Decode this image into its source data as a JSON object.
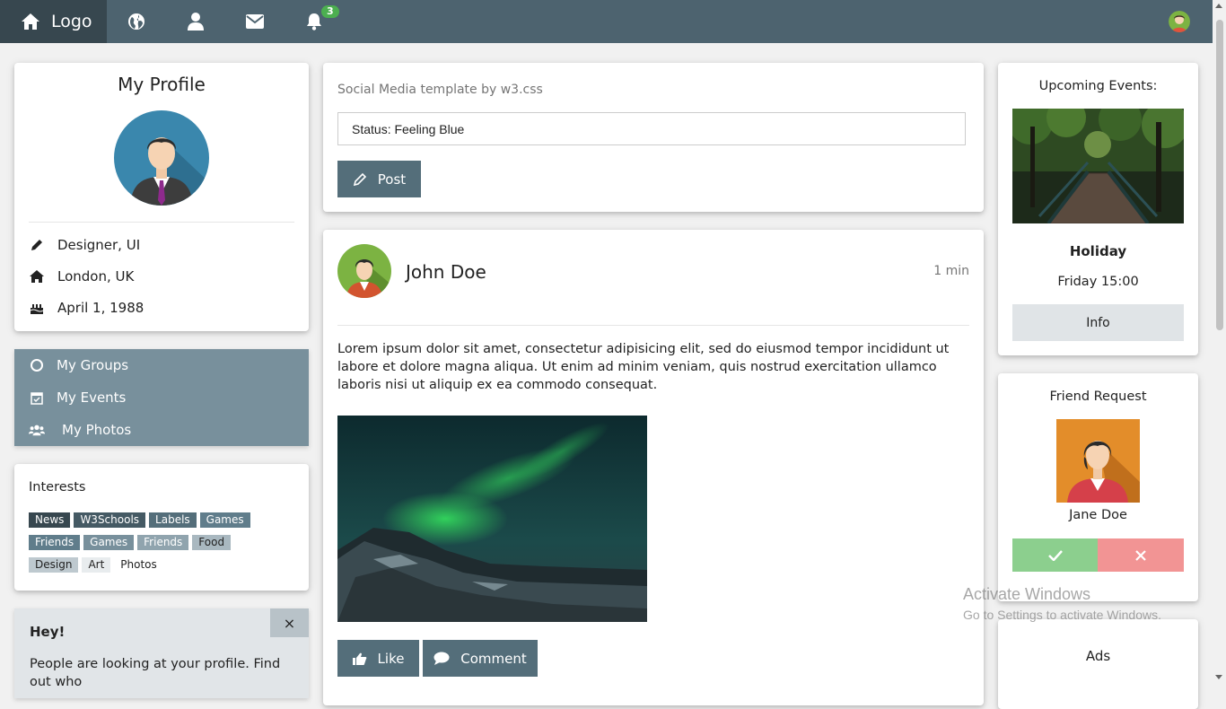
{
  "navbar": {
    "logo_label": "Logo",
    "notification_count": "3"
  },
  "profile": {
    "title": "My Profile",
    "job": "Designer, UI",
    "location": "London, UK",
    "birthday": "April 1, 1988"
  },
  "accordion": {
    "items": [
      {
        "label": "My Groups",
        "icon": "circle-icon"
      },
      {
        "label": "My Events",
        "icon": "calendar-check-icon"
      },
      {
        "label": "My Photos",
        "icon": "users-icon"
      }
    ]
  },
  "interests": {
    "title": "Interests",
    "tags": [
      {
        "label": "News",
        "bg": "#37474f",
        "fg": "#ffffff"
      },
      {
        "label": "W3Schools",
        "bg": "#455a64",
        "fg": "#ffffff"
      },
      {
        "label": "Labels",
        "bg": "#546e7a",
        "fg": "#ffffff"
      },
      {
        "label": "Games",
        "bg": "#607d8b",
        "fg": "#ffffff"
      },
      {
        "label": "Friends",
        "bg": "#607d8b",
        "fg": "#ffffff"
      },
      {
        "label": "Games",
        "bg": "#78909c",
        "fg": "#ffffff"
      },
      {
        "label": "Friends",
        "bg": "#90a4ae",
        "fg": "#ffffff"
      },
      {
        "label": "Food",
        "bg": "#a9b8c0",
        "fg": "#222222"
      },
      {
        "label": "Design",
        "bg": "#bec9cf",
        "fg": "#222222"
      },
      {
        "label": "Art",
        "bg": "#e8ecee",
        "fg": "#222222"
      },
      {
        "label": "Photos",
        "bg": "#ffffff",
        "fg": "#222222"
      }
    ]
  },
  "alert": {
    "title": "Hey!",
    "message": "People are looking at your profile. Find out who",
    "close_label": "×"
  },
  "composer": {
    "subtitle": "Social Media template by w3.css",
    "status_value": "Status: Feeling Blue",
    "post_label": "Post"
  },
  "post": {
    "author": "John Doe",
    "time": "1 min",
    "text": "Lorem ipsum dolor sit amet, consectetur adipisicing elit, sed do eiusmod tempor incididunt ut labore et dolore magna aliqua. Ut enim ad minim veniam, quis nostrud exercitation ullamco laboris nisi ut aliquip ex ea commodo consequat.",
    "like_label": "Like",
    "comment_label": "Comment"
  },
  "events": {
    "title": "Upcoming Events:",
    "event_name": "Holiday",
    "event_time": "Friday 15:00",
    "info_label": "Info"
  },
  "friend_request": {
    "title": "Friend Request",
    "name": "Jane Doe"
  },
  "ads": {
    "title": "Ads"
  },
  "watermark": {
    "line1": "Activate Windows",
    "line2": "Go to Settings to activate Windows."
  },
  "colors": {
    "navbar": "#4d636f",
    "logo_bg": "#37474f",
    "accent": "#546e7a",
    "accordion": "#78909c"
  }
}
